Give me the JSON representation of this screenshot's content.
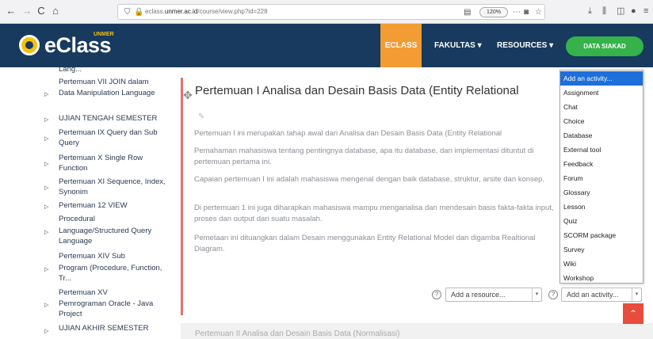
{
  "browser": {
    "url_prefix": "eclass.",
    "url_domain": "unmer.ac.id",
    "url_path": "/course/view.php?id=228",
    "zoom": "120%",
    "nav_back": "←",
    "nav_forward": "→",
    "nav_reload": "C",
    "nav_home": "⌂"
  },
  "header": {
    "logo_text": "eClass",
    "logo_super": "UNMER",
    "nav_eclass": "ECLASS",
    "nav_fakultas": "FAKULTAS ▾",
    "nav_resources": "RESOURCES ▾",
    "siakad_button": "DATA SIAKAD"
  },
  "sidebar": {
    "items": [
      {
        "label": "Lang...",
        "arrow": ""
      },
      {
        "label": "Pertemuan VII JOIN dalam",
        "arrow": ""
      },
      {
        "label": "Data Manipulation Language",
        "arrow": "▷"
      },
      {
        "label": "UJIAN TENGAH SEMESTER",
        "arrow": "▷"
      },
      {
        "label": "Pertemuan IX Query dan Sub Query",
        "arrow": "▷"
      },
      {
        "label": "Pertemuan X Single Row Function",
        "arrow": "▷"
      },
      {
        "label": "Pertemuan XI Sequence, Index, Synonim",
        "arrow": "▷"
      },
      {
        "label": "Pertemuan 12 VIEW",
        "arrow": "▷"
      },
      {
        "label": "Procedural",
        "arrow": ""
      },
      {
        "label": "Language/Structured Query Language",
        "arrow": "▷"
      },
      {
        "label": "Pertemuan XIV Sub",
        "arrow": ""
      },
      {
        "label": "Program (Procedure, Function, Tr...",
        "arrow": "▷"
      },
      {
        "label": "Pertemuan XV",
        "arrow": ""
      },
      {
        "label": "Pemrograman Oracle - Java Project",
        "arrow": "▷"
      },
      {
        "label": "UJIAN AKHIR SEMESTER",
        "arrow": "▷"
      }
    ]
  },
  "section": {
    "title": "Pertemuan I Analisa dan Desain Basis Data (Entity Relational",
    "paragraphs": [
      "Pertemuan I ini merupakan tahap awal dari Analisa dan Desain Basis Data (Entity Relational",
      "Pemahaman mahasiswa tentang pentingnya database, apa itu database, dan implementasi dituntut di pertemuan pertama ini.",
      "Capaian pertemuan I ini adalah mahasiswa mengenal dengan baik database, struktur, arsite dan konsep.",
      "Di pertemuan 1 ini juga diharapkan mahasiswa mampu menganalisa dan mendesain basis fakta-fakta input, proses dan output dari suatu masalah.",
      "Pemetaan ini dituangkan dalam Desain menggunakan Entity Relational Model dan digamba Realtional Diagram."
    ],
    "add_resource": "Add a resource...",
    "add_activity": "Add an activity...",
    "next_section": "Pertemuan II Analisa dan Desain Basis Data (Normalisasi)"
  },
  "dropdown": {
    "options": [
      "Add an activity...",
      "Assignment",
      "Chat",
      "Choice",
      "Database",
      "External tool",
      "Feedback",
      "Forum",
      "Glossary",
      "Lesson",
      "Quiz",
      "SCORM package",
      "Survey",
      "Wiki",
      "Workshop"
    ]
  },
  "colors": {
    "navbar": "#173a5e",
    "accent_orange": "#f39c34",
    "siakad_green": "#35b24a",
    "section_red": "#d7332b",
    "dropdown_highlight": "#1e6fd9"
  }
}
